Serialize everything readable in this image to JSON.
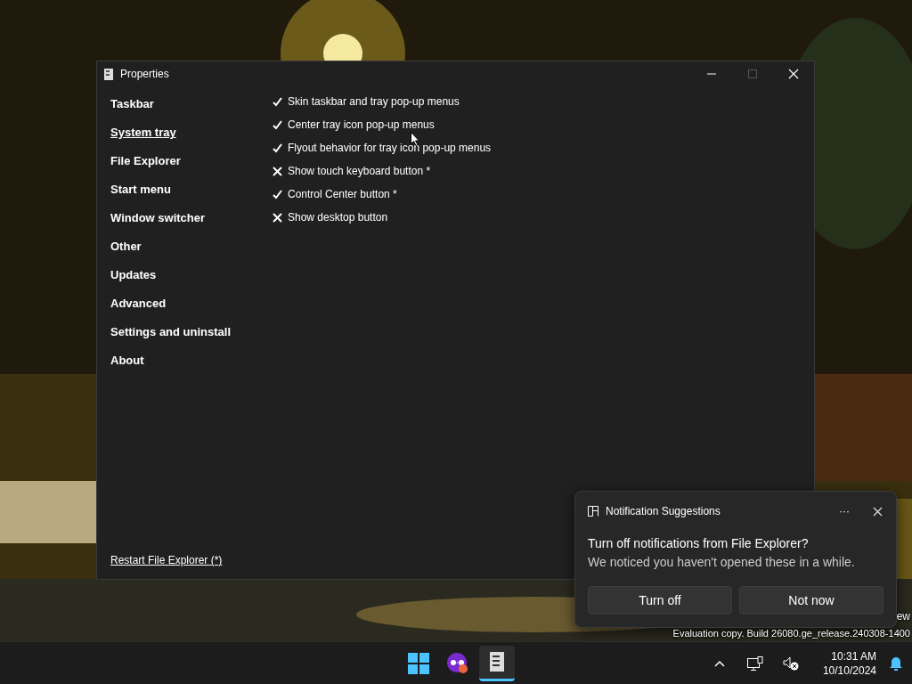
{
  "window": {
    "title": "Properties"
  },
  "sidebar": {
    "items": [
      {
        "label": "Taskbar",
        "selected": false
      },
      {
        "label": "System tray",
        "selected": true
      },
      {
        "label": "File Explorer",
        "selected": false
      },
      {
        "label": "Start menu",
        "selected": false
      },
      {
        "label": "Window switcher",
        "selected": false
      },
      {
        "label": "Other",
        "selected": false
      },
      {
        "label": "Updates",
        "selected": false
      },
      {
        "label": "Advanced",
        "selected": false
      },
      {
        "label": "Settings and uninstall",
        "selected": false
      },
      {
        "label": "About",
        "selected": false
      }
    ],
    "footer_link": "Restart File Explorer (*)"
  },
  "options": [
    {
      "label": "Skin taskbar and tray pop-up menus",
      "checked": true
    },
    {
      "label": "Center tray icon pop-up menus",
      "checked": true
    },
    {
      "label": "Flyout behavior for tray icon pop-up menus",
      "checked": true
    },
    {
      "label": "Show touch keyboard button *",
      "checked": false
    },
    {
      "label": "Control Center button *",
      "checked": true
    },
    {
      "label": "Show desktop button",
      "checked": false
    }
  ],
  "desktop_text": [
    "ew",
    "Evaluation copy. Build 26080.ge_release.240308-1400"
  ],
  "notification": {
    "app": "Notification Suggestions",
    "more": "···",
    "title": "Turn off notifications from File Explorer?",
    "body": "We noticed you haven't opened these in a while.",
    "buttons": [
      "Turn off",
      "Not now"
    ]
  },
  "taskbar": {
    "time": "10:31 AM",
    "date": "10/10/2024"
  }
}
